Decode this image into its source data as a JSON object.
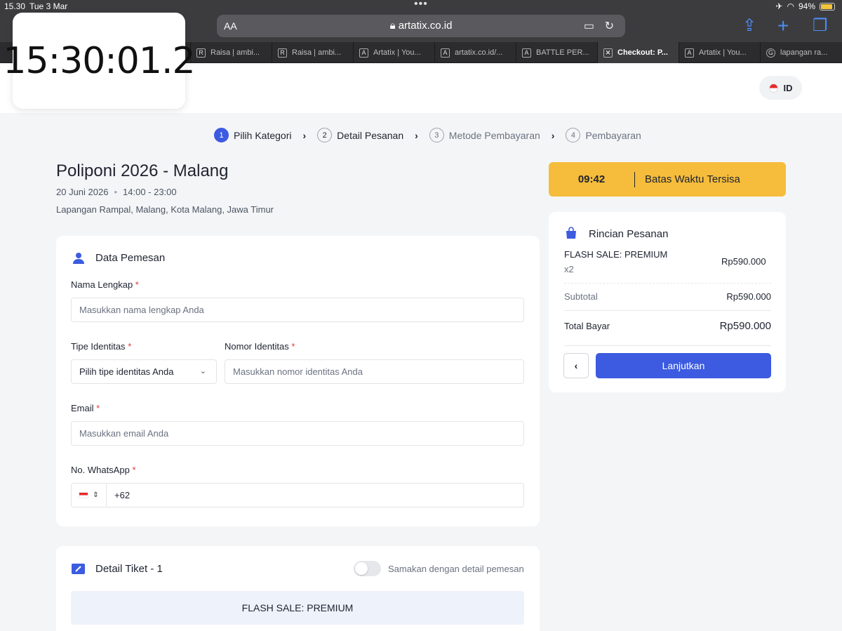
{
  "status": {
    "time": "15.30",
    "date": "Tue 3 Mar",
    "battery": "94%"
  },
  "browser": {
    "text_size": "AA",
    "url": "artatix.co.id"
  },
  "tabs": [
    {
      "title": "Raisa | ambi...",
      "fav": "R"
    },
    {
      "title": "Raisa | ambi...",
      "fav": "R"
    },
    {
      "title": "Artatix | You...",
      "fav": "A"
    },
    {
      "title": "artatix.co.id/...",
      "fav": "A"
    },
    {
      "title": "BATTLE PER...",
      "fav": "A"
    },
    {
      "title": "Checkout: P...",
      "fav": "✕"
    },
    {
      "title": "Artatix | You...",
      "fav": "A"
    },
    {
      "title": "lapangan ra...",
      "fav": "G"
    }
  ],
  "clock": "15:30:01.2",
  "lang": "ID",
  "steps": [
    {
      "num": "1",
      "label": "Pilih Kategori"
    },
    {
      "num": "2",
      "label": "Detail Pesanan"
    },
    {
      "num": "3",
      "label": "Metode Pembayaran"
    },
    {
      "num": "4",
      "label": "Pembayaran"
    }
  ],
  "event": {
    "title": "Poliponi 2026 - Malang",
    "date": "20 Juni 2026",
    "time": "14:00 - 23:00",
    "location": "Lapangan Rampal, Malang, Kota Malang, Jawa Timur"
  },
  "form": {
    "title": "Data Pemesan",
    "name_label": "Nama Lengkap",
    "name_placeholder": "Masukkan nama lengkap Anda",
    "idtype_label": "Tipe Identitas",
    "idtype_placeholder": "Pilih tipe identitas Anda",
    "idnum_label": "Nomor Identitas",
    "idnum_placeholder": "Masukkan nomor identitas Anda",
    "email_label": "Email",
    "email_placeholder": "Masukkan email Anda",
    "wa_label": "No. WhatsApp",
    "wa_value": "+62",
    "required": "*"
  },
  "ticket": {
    "title": "Detail Tiket - 1",
    "toggle_label": "Samakan dengan detail pemesan",
    "category": "FLASH SALE: PREMIUM"
  },
  "timer": {
    "time": "09:42",
    "label": "Batas Waktu Tersisa"
  },
  "summary": {
    "title": "Rincian Pesanan",
    "item": "FLASH SALE: PREMIUM",
    "qty": "x2",
    "item_price": "Rp590.000",
    "subtotal_label": "Subtotal",
    "subtotal": "Rp590.000",
    "total_label": "Total Bayar",
    "total": "Rp590.000",
    "next": "Lanjutkan",
    "back": "‹"
  },
  "colors": {
    "primary": "#3c5be0",
    "timer": "#f5bd3b",
    "required": "#e53935"
  }
}
